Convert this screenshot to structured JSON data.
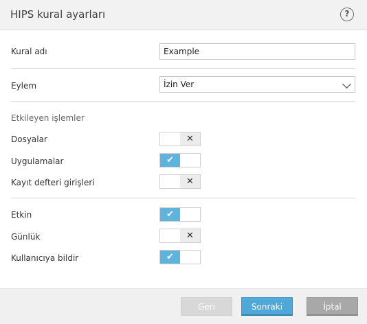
{
  "dialog": {
    "title": "HIPS kural ayarları",
    "help_label": "?"
  },
  "rule_name": {
    "label": "Kural adı",
    "value": "Example"
  },
  "action": {
    "label": "Eylem",
    "selected": "İzin Ver"
  },
  "affecting_operations": {
    "heading": "Etkileyen işlemler",
    "items": [
      {
        "label": "Dosyalar",
        "enabled": false
      },
      {
        "label": "Uygulamalar",
        "enabled": true
      },
      {
        "label": "Kayıt defteri girişleri",
        "enabled": false
      }
    ]
  },
  "options": {
    "items": [
      {
        "label": "Etkin",
        "enabled": true
      },
      {
        "label": "Günlük",
        "enabled": false
      },
      {
        "label": "Kullanıcıya bildir",
        "enabled": true
      }
    ]
  },
  "glyphs": {
    "on": "✔",
    "off": "✕"
  },
  "footer": {
    "back_label": "Geri",
    "next_label": "Sonraki",
    "cancel_label": "İptal"
  },
  "colors": {
    "accent": "#5fb3dc",
    "primary_button": "#4fa8d8",
    "cancel_button": "#a8a8a8",
    "disabled_button": "#d8d8d8"
  }
}
